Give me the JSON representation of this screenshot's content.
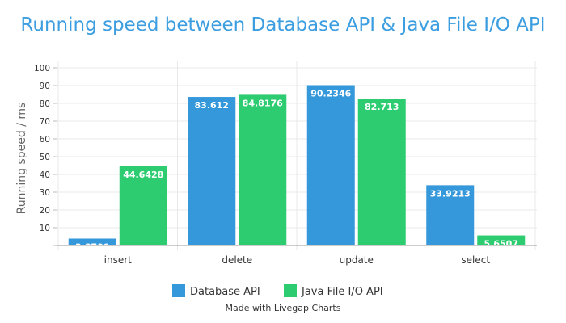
{
  "chart_data": {
    "type": "bar",
    "title": "Running speed between Database API & Java File I/O API",
    "xlabel": "",
    "ylabel": "Running speed / ms",
    "categories": [
      "insert",
      "delete",
      "update",
      "select"
    ],
    "series": [
      {
        "name": "Database API",
        "values": [
          3.8709,
          83.612,
          90.2346,
          33.9213
        ],
        "labels": [
          "3.8709",
          "83.612",
          "90.2346",
          "33.9213"
        ]
      },
      {
        "name": "Java File I/O API",
        "values": [
          44.6428,
          84.8176,
          82.713,
          5.6507
        ],
        "labels": [
          "44.6428",
          "84.8176",
          "82.713",
          "5.6507"
        ]
      }
    ],
    "ylim": [
      0,
      100
    ],
    "yticks": [
      0,
      10,
      20,
      30,
      40,
      50,
      60,
      70,
      80,
      90,
      100
    ],
    "ytick_labels": [
      "",
      "10",
      "20",
      "30",
      "40",
      "50",
      "60",
      "70",
      "80",
      "90",
      "100"
    ],
    "grid": true,
    "legend_position": "bottom-center",
    "colors": [
      "#3498db",
      "#2ecc71"
    ],
    "credit": "Made with Livegap Charts"
  }
}
